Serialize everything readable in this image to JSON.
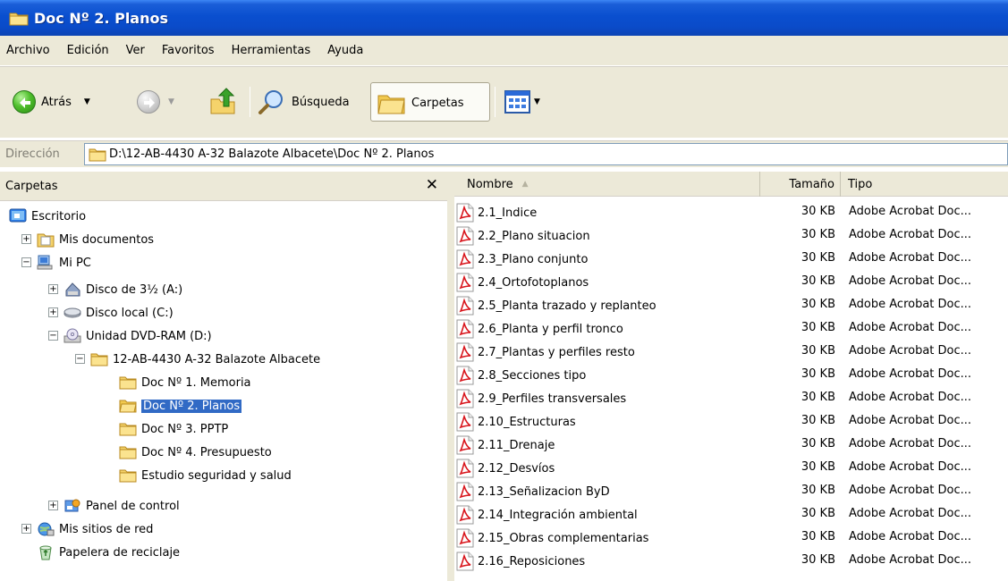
{
  "window": {
    "title": "Doc Nº 2. Planos"
  },
  "menu": [
    "Archivo",
    "Edición",
    "Ver",
    "Favoritos",
    "Herramientas",
    "Ayuda"
  ],
  "toolbar": {
    "back_label": "Atrás",
    "search_label": "Búsqueda",
    "folders_label": "Carpetas"
  },
  "address": {
    "label": "Dirección",
    "value": "D:\\12-AB-4430 A-32 Balazote Albacete\\Doc Nº 2. Planos"
  },
  "folders_pane": {
    "header": "Carpetas",
    "tree": [
      {
        "label": "Escritorio",
        "icon": "desktop-icon"
      },
      {
        "label": "Mis documentos",
        "icon": "my-documents-icon"
      },
      {
        "label": "Mi PC",
        "icon": "my-computer-icon"
      },
      {
        "label": "Disco de 3½ (A:)",
        "icon": "floppy-drive-icon"
      },
      {
        "label": "Disco local (C:)",
        "icon": "hard-drive-icon"
      },
      {
        "label": "Unidad DVD-RAM (D:)",
        "icon": "dvd-drive-icon"
      },
      {
        "label": "12-AB-4430 A-32 Balazote Albacete",
        "icon": "folder-icon"
      },
      {
        "label": "Doc Nº 1. Memoria",
        "icon": "folder-icon"
      },
      {
        "label": "Doc Nº 2. Planos",
        "icon": "folder-icon",
        "selected": true
      },
      {
        "label": "Doc Nº 3. PPTP",
        "icon": "folder-icon"
      },
      {
        "label": "Doc Nº 4. Presupuesto",
        "icon": "folder-icon"
      },
      {
        "label": "Estudio seguridad y salud",
        "icon": "folder-icon"
      },
      {
        "label": "Panel de control",
        "icon": "control-panel-icon"
      },
      {
        "label": "Mis sitios de red",
        "icon": "network-places-icon"
      },
      {
        "label": "Papelera de reciclaje",
        "icon": "recycle-bin-icon"
      }
    ]
  },
  "file_list": {
    "columns": {
      "name": "Nombre",
      "size": "Tamaño",
      "type": "Tipo"
    },
    "files": [
      {
        "name": "2.1_Indice",
        "size": "30 KB",
        "type": "Adobe Acrobat Doc..."
      },
      {
        "name": "2.2_Plano situacion",
        "size": "30 KB",
        "type": "Adobe Acrobat Doc..."
      },
      {
        "name": "2.3_Plano conjunto",
        "size": "30 KB",
        "type": "Adobe Acrobat Doc..."
      },
      {
        "name": "2.4_Ortofotoplanos",
        "size": "30 KB",
        "type": "Adobe Acrobat Doc..."
      },
      {
        "name": "2.5_Planta trazado y replanteo",
        "size": "30 KB",
        "type": "Adobe Acrobat Doc..."
      },
      {
        "name": "2.6_Planta y perfil tronco",
        "size": "30 KB",
        "type": "Adobe Acrobat Doc..."
      },
      {
        "name": "2.7_Plantas y perfiles resto",
        "size": "30 KB",
        "type": "Adobe Acrobat Doc..."
      },
      {
        "name": "2.8_Secciones tipo",
        "size": "30 KB",
        "type": "Adobe Acrobat Doc..."
      },
      {
        "name": "2.9_Perfiles transversales",
        "size": "30 KB",
        "type": "Adobe Acrobat Doc..."
      },
      {
        "name": "2.10_Estructuras",
        "size": "30 KB",
        "type": "Adobe Acrobat Doc..."
      },
      {
        "name": "2.11_Drenaje",
        "size": "30 KB",
        "type": "Adobe Acrobat Doc..."
      },
      {
        "name": "2.12_Desvíos",
        "size": "30 KB",
        "type": "Adobe Acrobat Doc..."
      },
      {
        "name": "2.13_Señalizacion ByD",
        "size": "30 KB",
        "type": "Adobe Acrobat Doc..."
      },
      {
        "name": "2.14_Integración ambiental",
        "size": "30 KB",
        "type": "Adobe Acrobat Doc..."
      },
      {
        "name": "2.15_Obras complementarias",
        "size": "30 KB",
        "type": "Adobe Acrobat Doc..."
      },
      {
        "name": "2.16_Reposiciones",
        "size": "30 KB",
        "type": "Adobe Acrobat Doc..."
      }
    ]
  },
  "colors": {
    "titlebar": "#0a4fcf",
    "chrome": "#ece9d8",
    "selection": "#316ac5",
    "address_border": "#7f9db9"
  }
}
